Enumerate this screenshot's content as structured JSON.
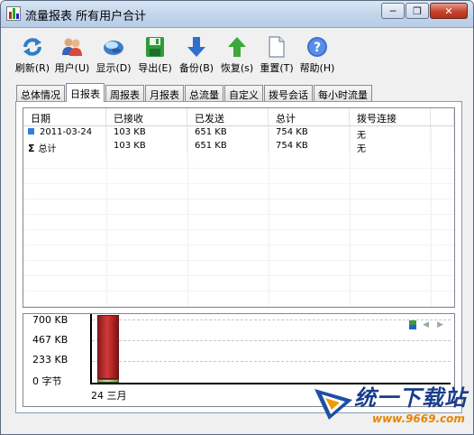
{
  "window": {
    "title": "流量报表  所有用户合计",
    "minimize_label": "─",
    "restore_label": "❐",
    "close_label": "✕"
  },
  "toolbar": {
    "items": [
      {
        "label": "刷新(R)",
        "icon": "refresh-icon"
      },
      {
        "label": "用户(U)",
        "icon": "users-icon"
      },
      {
        "label": "显示(D)",
        "icon": "display-icon"
      },
      {
        "label": "导出(E)",
        "icon": "export-icon"
      },
      {
        "label": "备份(B)",
        "icon": "backup-icon"
      },
      {
        "label": "恢复(s)",
        "icon": "restore-icon"
      },
      {
        "label": "重置(T)",
        "icon": "reset-icon"
      },
      {
        "label": "帮助(H)",
        "icon": "help-icon"
      }
    ]
  },
  "tabs": [
    {
      "label": "总体情况",
      "active": false
    },
    {
      "label": "日报表",
      "active": true
    },
    {
      "label": "周报表",
      "active": false
    },
    {
      "label": "月报表",
      "active": false
    },
    {
      "label": "总流量",
      "active": false
    },
    {
      "label": "自定义",
      "active": false
    },
    {
      "label": "拨号会话",
      "active": false
    },
    {
      "label": "每小时流量",
      "active": false
    }
  ],
  "table": {
    "columns": [
      "日期",
      "已接收",
      "已发送",
      "总计",
      "拨号连接"
    ],
    "rows": [
      {
        "date": "2011-03-24",
        "received": "103 KB",
        "sent": "651 KB",
        "total": "754 KB",
        "dialup": "无",
        "icon": "day-icon"
      },
      {
        "date": "总计",
        "received": "103 KB",
        "sent": "651 KB",
        "total": "754 KB",
        "dialup": "无",
        "icon": "sum-icon"
      }
    ]
  },
  "chart_data": {
    "type": "bar",
    "categories": [
      "24 三月"
    ],
    "series": [
      {
        "values": [
          651
        ],
        "color": "#c02a2a"
      },
      {
        "values": [
          103
        ],
        "color": "#a8c48a"
      }
    ],
    "y_ticks": [
      "700 KB",
      "467 KB",
      "233 KB",
      "0 字节"
    ],
    "ylim": [
      0,
      700
    ],
    "grid": true
  },
  "watermark": {
    "text": "统一下载站",
    "url": "www.9669.com"
  }
}
